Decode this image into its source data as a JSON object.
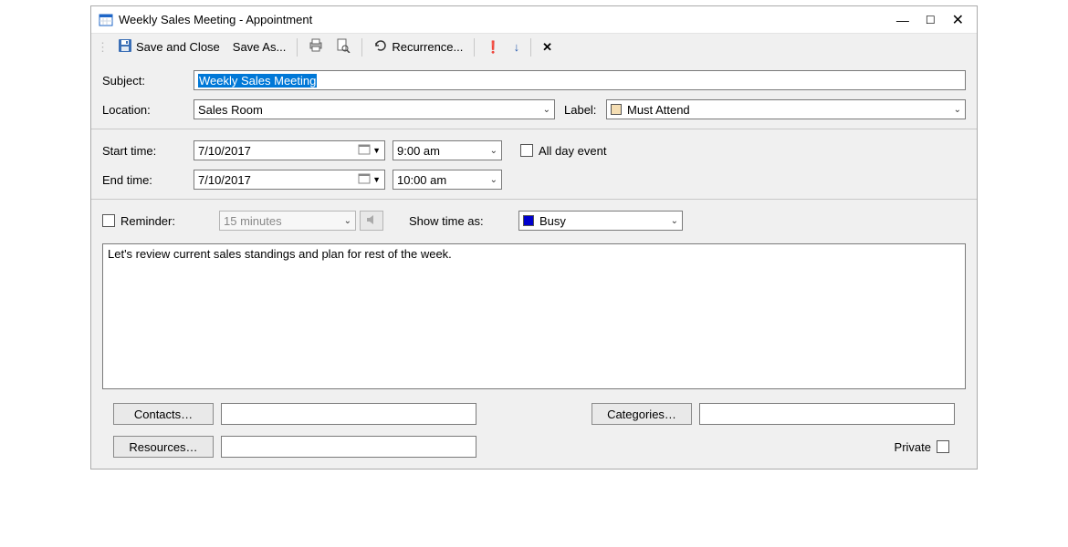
{
  "window": {
    "title": "Weekly Sales Meeting - Appointment"
  },
  "toolbar": {
    "save_close": "Save and Close",
    "save_as": "Save As...",
    "recurrence": "Recurrence..."
  },
  "labels": {
    "subject": "Subject:",
    "location": "Location:",
    "label": "Label:",
    "start_time": "Start time:",
    "end_time": "End time:",
    "all_day": "All day event",
    "reminder": "Reminder:",
    "show_time_as": "Show time as:",
    "contacts": "Contacts…",
    "categories": "Categories…",
    "resources": "Resources…",
    "private": "Private"
  },
  "values": {
    "subject": "Weekly Sales Meeting",
    "location": "Sales Room",
    "label_selected": "Must Attend",
    "start_date": "7/10/2017",
    "start_time": "9:00 am",
    "end_date": "7/10/2017",
    "end_time": "10:00 am",
    "reminder": "15 minutes",
    "show_time_as": "Busy",
    "description": "Let's review current sales standings and plan for rest of the week.",
    "contacts": "",
    "categories": "",
    "resources": ""
  },
  "colors": {
    "label_swatch": "#f5deb3",
    "busy_swatch": "#0000cd",
    "selection": "#0078d7"
  }
}
